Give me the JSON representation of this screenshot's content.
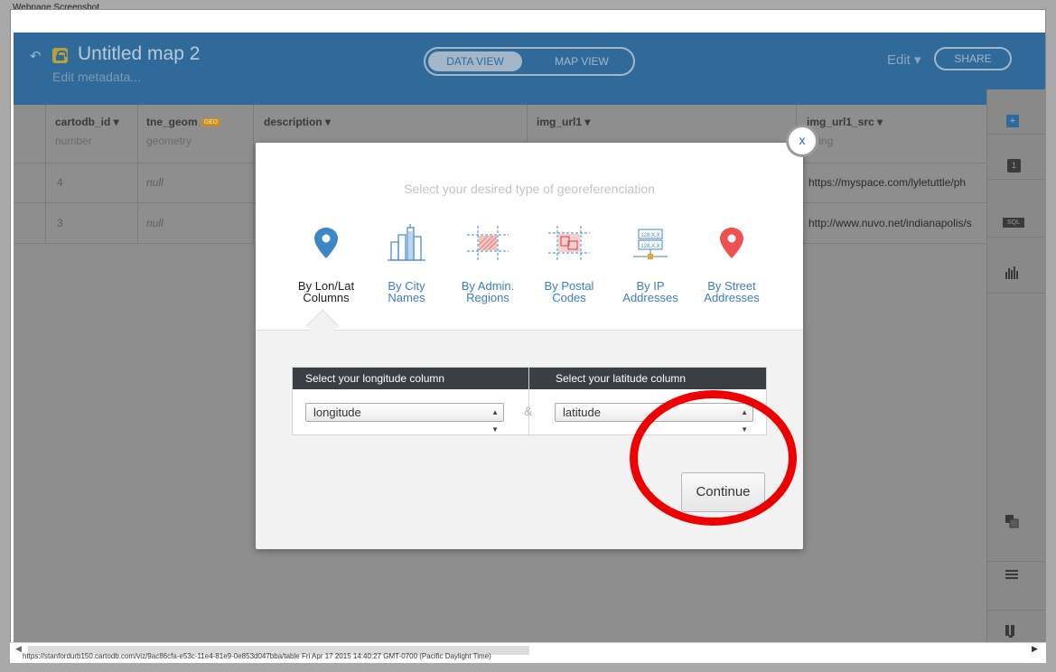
{
  "window": {
    "caption": "Webpage Screenshot"
  },
  "header": {
    "title": "Untitled map 2",
    "metadata_link": "Edit metadata...",
    "view_toggle": {
      "data_view": "DATA VIEW",
      "map_view": "MAP VIEW",
      "active": "DATA VIEW"
    },
    "edit_menu": "Edit ▾",
    "share_label": "SHARE"
  },
  "table": {
    "columns": [
      {
        "name": "cartodb_id ▾",
        "type": "number"
      },
      {
        "name": "tne_geom",
        "badge": "GEO",
        "type": "geometry"
      },
      {
        "name": "description ▾",
        "type": ""
      },
      {
        "name": "img_url1 ▾",
        "type": ""
      },
      {
        "name": "img_url1_src ▾",
        "type": "string"
      }
    ],
    "rows": [
      {
        "cartodb_id": "4",
        "tne_geom": "null",
        "img_url1_src": "https://myspace.com/lyletuttle/ph"
      },
      {
        "cartodb_id": "3",
        "tne_geom": "null",
        "img_url1_src": "http://www.nuvo.net/indianapolis/s"
      }
    ]
  },
  "sidebar": {
    "items": [
      {
        "icon": "add-layer-icon",
        "label": "+"
      },
      {
        "icon": "layer-number-icon",
        "label": "1"
      },
      {
        "icon": "sql-icon",
        "label": "SQL"
      },
      {
        "icon": "bar-chart-icon"
      },
      {
        "icon": "merge-icon"
      },
      {
        "icon": "add-row-icon"
      },
      {
        "icon": "add-column-icon"
      }
    ]
  },
  "modal": {
    "close_label": "x",
    "subtitle": "Select your desired type of georeferenciation",
    "options": [
      {
        "label": "By Lon/Lat\nColumns",
        "icon": "map-pin-blue-icon",
        "active": true
      },
      {
        "label": "By City\nNames",
        "icon": "city-skyline-icon"
      },
      {
        "label": "By Admin.\nRegions",
        "icon": "admin-regions-icon"
      },
      {
        "label": "By Postal\nCodes",
        "icon": "postal-codes-icon"
      },
      {
        "label": "By IP\nAddresses",
        "icon": "ip-address-icon",
        "ip_text": "128.X.X"
      },
      {
        "label": "By Street\nAddresses",
        "icon": "map-pin-red-icon"
      }
    ],
    "longitude": {
      "header": "Select your longitude column",
      "value": "longitude"
    },
    "latitude": {
      "header": "Select your latitude column",
      "value": "latitude"
    },
    "separator": "&",
    "continue_label": "Continue"
  },
  "annotation": {
    "color": "#ee0000"
  },
  "status": {
    "text": "https://stanfordurb150.cartodb.com/viz/9ac86cfa-e53c-11e4-81e9-0e853d047bba/table Fri Apr 17 2015 14:40:27 GMT-0700 (Pacific Daylight Time)"
  },
  "colors": {
    "header": "#2f6a9a",
    "accent": "#3c7fbf",
    "geo_badge": "#c98a24"
  }
}
